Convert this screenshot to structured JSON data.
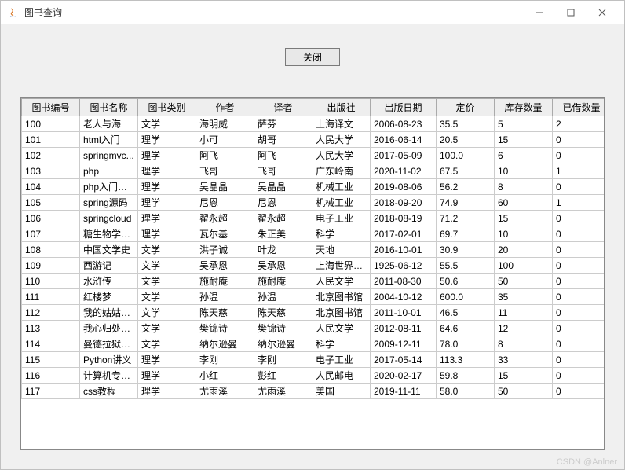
{
  "window": {
    "title": "图书查询",
    "minimize_icon": "minimize-icon",
    "maximize_icon": "maximize-icon",
    "close_icon": "close-icon"
  },
  "button": {
    "close_label": "关闭"
  },
  "table": {
    "headers": [
      "图书编号",
      "图书名称",
      "图书类别",
      "作者",
      "译者",
      "出版社",
      "出版日期",
      "定价",
      "库存数量",
      "已借数量"
    ],
    "rows": [
      [
        "100",
        "老人与海",
        "文学",
        "海明威",
        "萨芬",
        "上海译文",
        "2006-08-23",
        "35.5",
        "5",
        "2"
      ],
      [
        "101",
        "html入门",
        "理学",
        "小可",
        "胡哥",
        "人民大学",
        "2016-06-14",
        "20.5",
        "15",
        "0"
      ],
      [
        "102",
        "springmvc...",
        "理学",
        "阿飞",
        "阿飞",
        "人民大学",
        "2017-05-09",
        "100.0",
        "6",
        "0"
      ],
      [
        "103",
        "php",
        "理学",
        "飞哥",
        "飞哥",
        "广东岭南",
        "2020-11-02",
        "67.5",
        "10",
        "1"
      ],
      [
        "104",
        "php入门到...",
        "理学",
        "吴晶晶",
        "吴晶晶",
        "机械工业",
        "2019-08-06",
        "56.2",
        "8",
        "0"
      ],
      [
        "105",
        " spring源码",
        "理学",
        "尼恩",
        "尼恩",
        "机械工业",
        "2018-09-20",
        "74.9",
        "60",
        "1"
      ],
      [
        "106",
        "springcloud",
        "理学",
        "翟永超",
        "翟永超",
        "电子工业",
        "2018-08-19",
        "71.2",
        "15",
        "0"
      ],
      [
        "107",
        "糖生物学基础",
        "理学",
        "瓦尔基",
        "朱正美",
        "科学",
        "2017-02-01",
        "69.7",
        "10",
        "0"
      ],
      [
        "108",
        "中国文学史",
        "文学",
        "洪子诚",
        "叶龙",
        "天地",
        "2016-10-01",
        "30.9",
        "20",
        "0"
      ],
      [
        "109",
        "西游记",
        "文学",
        "吴承恩",
        "吴承恩",
        "上海世界书...",
        "1925-06-12",
        "55.5",
        "100",
        "0"
      ],
      [
        "110",
        "水浒传",
        "文学",
        "施耐庵",
        "施耐庵",
        "人民文学",
        "2011-08-30",
        "50.6",
        "50",
        "0"
      ],
      [
        "111",
        "红楼梦",
        "文学",
        "孙温",
        "孙温",
        "北京图书馆",
        "2004-10-12",
        "600.0",
        "35",
        "0"
      ],
      [
        "112",
        "我的姑姑三毛",
        "文学",
        "陈天慈",
        "陈天慈",
        "北京图书馆",
        "2011-10-01",
        "46.5",
        "11",
        "0"
      ],
      [
        "113",
        "我心归处是...",
        "文学",
        "樊锦诗",
        "樊锦诗",
        "人民文学",
        "2012-08-11",
        "64.6",
        "12",
        "0"
      ],
      [
        "114",
        "曼德拉狱中...",
        "文学",
        "纳尔逊曼",
        "纳尔逊曼",
        "科学",
        "2009-12-11",
        "78.0",
        "8",
        "0"
      ],
      [
        "115",
        "Python讲义",
        "理学",
        "李刚",
        "李刚",
        "电子工业",
        "2017-05-14",
        "113.3",
        "33",
        "0"
      ],
      [
        "116",
        "计算机专业...",
        "理学",
        "小红",
        "彭红",
        "人民邮电",
        "2020-02-17",
        "59.8",
        "15",
        "0"
      ],
      [
        "117",
        "css教程",
        "理学",
        "尤雨溪",
        "尤雨溪",
        "美国",
        "2019-11-11",
        "58.0",
        "50",
        "0"
      ]
    ]
  },
  "watermark": "CSDN @Anlner"
}
